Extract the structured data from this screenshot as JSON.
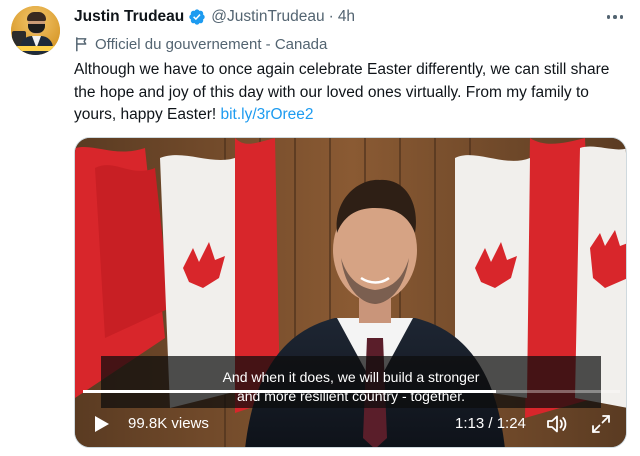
{
  "tweet": {
    "author_name": "Justin Trudeau",
    "handle": "@JustinTrudeau",
    "separator": "·",
    "time": "4h",
    "label": "Officiel du gouvernement - Canada",
    "text_main": "Although we have to once again celebrate Easter differently, we can still share the hope and joy of this day with our loved ones virtually. From my family to yours, happy Easter!",
    "link_text": "bit.ly/3rOree2",
    "icons": {
      "verified": "verified-badge-icon",
      "more": "more-options-icon",
      "label": "flag-icon"
    },
    "colors": {
      "verified": "#1d9bf0",
      "link": "#1d9bf0",
      "muted": "#536471"
    }
  },
  "video": {
    "caption_line1": "And when it does, we will build a stronger",
    "caption_line2": "and more resilient country - together.",
    "progress": 0.77,
    "views": "99.8K views",
    "timecode": "1:13 / 1:24",
    "icons": {
      "play": "play-icon",
      "volume": "volume-icon",
      "fullscreen": "fullscreen-icon"
    }
  }
}
